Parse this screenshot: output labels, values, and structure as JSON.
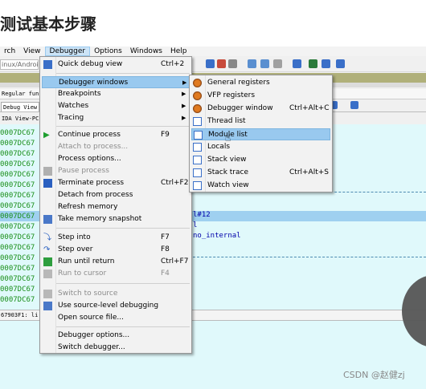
{
  "heading": "测试基本步骤",
  "menubar": {
    "items": [
      "rch",
      "View",
      "Debugger",
      "Options",
      "Windows",
      "Help"
    ],
    "active_index": 2
  },
  "toolbar": {
    "path_text": "inux/Android"
  },
  "tabs": {
    "row1_left": "Regular func",
    "row2_left": "Debug View",
    "row3_left": "IDA View-PC"
  },
  "code": {
    "addresses": [
      "0007DC67",
      "0007DC67",
      "0007DC67",
      "0007DC67",
      "0007DC67",
      "0007DC67",
      "0007DC67",
      "0007DC67",
      "0007DC67",
      "0007DC67",
      "0007DC67",
      "0007DC67",
      "0007DC67",
      "0007DC67",
      "0007DC67",
      "0007DC67",
      "0007DC67"
    ],
    "fragment_1": "l#12",
    "fragment_2": "l",
    "fragment_3": "no_internal"
  },
  "status_text": "67903F1: li",
  "debugger_menu": {
    "items": [
      {
        "label": "Quick debug view",
        "shortcut": "Ctrl+2",
        "icon": "quick-debug-icon",
        "disabled": false
      },
      {
        "label": "Debugger windows",
        "submenu": true,
        "highlighted": true
      },
      {
        "label": "Breakpoints",
        "submenu": true
      },
      {
        "label": "Watches",
        "submenu": true
      },
      {
        "label": "Tracing",
        "submenu": true
      },
      {
        "label": "Continue process",
        "shortcut": "F9",
        "icon": "play-icon",
        "disabled": false
      },
      {
        "label": "Attach to process...",
        "disabled": true
      },
      {
        "label": "Process options...",
        "disabled": false
      },
      {
        "label": "Pause process",
        "icon": "pause-icon",
        "disabled": true
      },
      {
        "label": "Terminate process",
        "shortcut": "Ctrl+F2",
        "icon": "stop-icon",
        "disabled": false
      },
      {
        "label": "Detach from process",
        "disabled": false
      },
      {
        "label": "Refresh memory",
        "disabled": false
      },
      {
        "label": "Take memory snapshot",
        "icon": "snapshot-icon",
        "disabled": false
      },
      {
        "label": "Step into",
        "shortcut": "F7",
        "icon": "step-into-icon",
        "disabled": false
      },
      {
        "label": "Step over",
        "shortcut": "F8",
        "icon": "step-over-icon",
        "disabled": false
      },
      {
        "label": "Run until return",
        "shortcut": "Ctrl+F7",
        "icon": "run-until-return-icon",
        "disabled": false
      },
      {
        "label": "Run to cursor",
        "shortcut": "F4",
        "icon": "run-to-cursor-icon",
        "disabled": true
      },
      {
        "label": "Switch to source",
        "icon": "switch-source-icon",
        "disabled": true
      },
      {
        "label": "Use source-level debugging",
        "icon": "source-debug-icon",
        "disabled": false
      },
      {
        "label": "Open source file...",
        "disabled": false
      },
      {
        "label": "Debugger options...",
        "disabled": false
      },
      {
        "label": "Switch debugger...",
        "disabled": false
      }
    ]
  },
  "windows_submenu": {
    "items": [
      {
        "label": "General registers",
        "shortcut": "",
        "icon": "bug-icon"
      },
      {
        "label": "VFP registers",
        "shortcut": "",
        "icon": "bug-icon"
      },
      {
        "label": "Debugger window",
        "shortcut": "Ctrl+Alt+C",
        "icon": "bug-icon"
      },
      {
        "label": "Thread list",
        "shortcut": "",
        "icon": "thread-list-icon"
      },
      {
        "label": "Module list",
        "shortcut": "",
        "icon": "module-list-icon",
        "highlighted": true
      },
      {
        "label": "Locals",
        "shortcut": "",
        "icon": "locals-icon"
      },
      {
        "label": "Stack view",
        "shortcut": "",
        "icon": "stack-view-icon"
      },
      {
        "label": "Stack trace",
        "shortcut": "Ctrl+Alt+S",
        "icon": "stack-trace-icon"
      },
      {
        "label": "Watch view",
        "shortcut": "",
        "icon": "watch-view-icon"
      }
    ]
  },
  "colors": {
    "code_bg": "#e0f9fb",
    "address": "#1a8f1a",
    "highlight": "#99c9ef"
  },
  "watermark": "CSDN @赵健zj"
}
